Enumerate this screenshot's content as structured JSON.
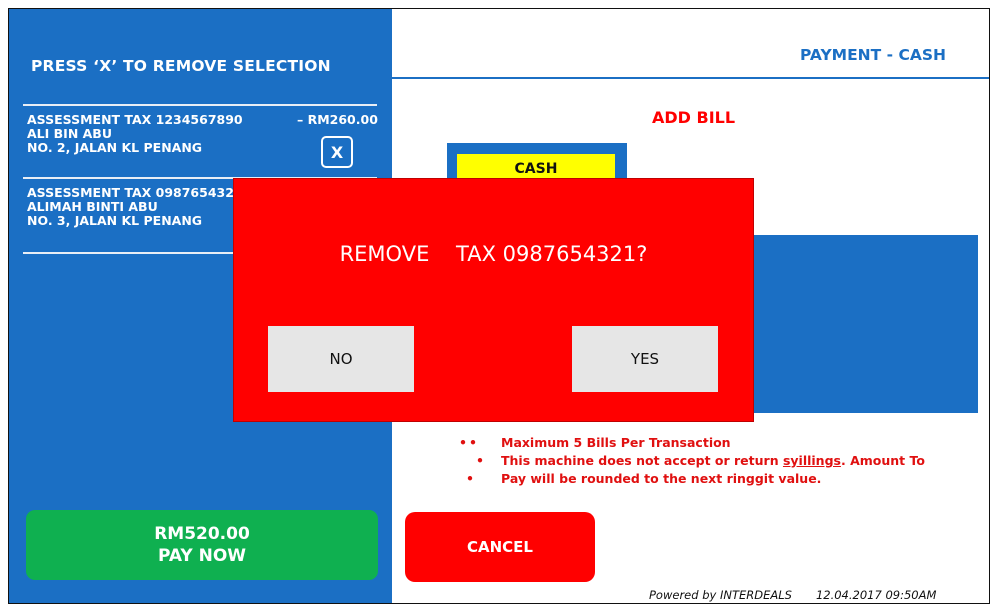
{
  "left": {
    "title": "PRESS ‘X’ TO REMOVE SELECTION",
    "selections": [
      {
        "title": "ASSESSMENT TAX 1234567890",
        "amount": "– RM260.00",
        "name": "ALI BIN ABU",
        "address": "NO. 2, JALAN KL PENANG"
      },
      {
        "title": "ASSESSMENT TAX 0987654321",
        "name": "ALIMAH BINTI ABU",
        "address": "NO. 3, JALAN KL PENANG"
      }
    ],
    "remove_label": "X",
    "pay_amount": "RM520.00",
    "pay_label": "PAY NOW"
  },
  "right": {
    "title": "PAYMENT - CASH",
    "add_bill": "ADD BILL",
    "cash_label": "CASH",
    "notes": {
      "line1": "Maximum 5 Bills Per Transaction",
      "line2_before": "This machine does not accept or return ",
      "line2_link": "syillings",
      "line2_after": ". Amount To",
      "line3": "Pay will be rounded to the next ringgit value."
    },
    "cancel_label": "CANCEL",
    "powered_by": "Powered by INTERDEALS",
    "timestamp": "12.04.2017  09:50AM"
  },
  "modal": {
    "message": "REMOVE    TAX 0987654321?",
    "no_label": "NO",
    "yes_label": "YES"
  },
  "colors": {
    "panel_blue": "#1b6fc4",
    "alert_red": "#ff0000",
    "pay_green": "#0fb050",
    "highlight_yellow": "#ffff00"
  }
}
